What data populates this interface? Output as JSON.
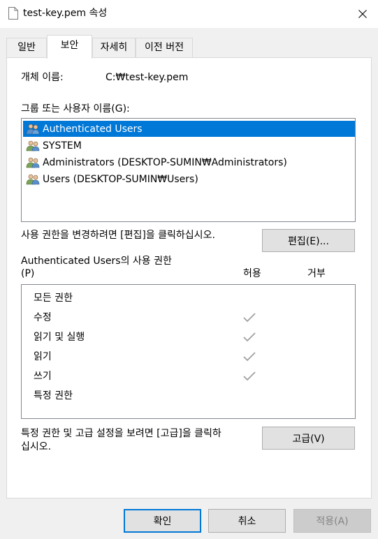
{
  "window": {
    "title": "test-key.pem 속성"
  },
  "tabs": [
    {
      "label": "일반"
    },
    {
      "label": "보안"
    },
    {
      "label": "자세히"
    },
    {
      "label": "이전 버전"
    }
  ],
  "security": {
    "object_name_label": "개체 이름:",
    "object_name_value": "C:₩test-key.pem",
    "groups_label": "그룹 또는 사용자 이름(G):",
    "groups": [
      {
        "name": "Authenticated Users",
        "selected": true
      },
      {
        "name": "SYSTEM",
        "selected": false
      },
      {
        "name": "Administrators (DESKTOP-SUMIN₩Administrators)",
        "selected": false
      },
      {
        "name": "Users (DESKTOP-SUMIN₩Users)",
        "selected": false
      }
    ],
    "edit_hint": "사용 권한을 변경하려면 [편집]을 클릭하십시오.",
    "edit_button": "편집(E)...",
    "perm_title_line1": "Authenticated Users의 사용 권한",
    "perm_title_line2": "(P)",
    "allow_header": "허용",
    "deny_header": "거부",
    "permissions": [
      {
        "name": "모든 권한",
        "allow": false,
        "deny": false
      },
      {
        "name": "수정",
        "allow": true,
        "deny": false
      },
      {
        "name": "읽기 및 실행",
        "allow": true,
        "deny": false
      },
      {
        "name": "읽기",
        "allow": true,
        "deny": false
      },
      {
        "name": "쓰기",
        "allow": true,
        "deny": false
      },
      {
        "name": "특정 권한",
        "allow": false,
        "deny": false
      }
    ],
    "advanced_hint_line1": "특정 권한 및 고급 설정을 보려면 [고급]을 클릭하",
    "advanced_hint_line2": "십시오.",
    "advanced_button": "고급(V)"
  },
  "footer": {
    "ok": "확인",
    "cancel": "취소",
    "apply": "적용(A)"
  },
  "colors": {
    "selection": "#0078d7",
    "check_gray": "#a0a0a0",
    "dialog_bg": "#f0f0f0"
  }
}
